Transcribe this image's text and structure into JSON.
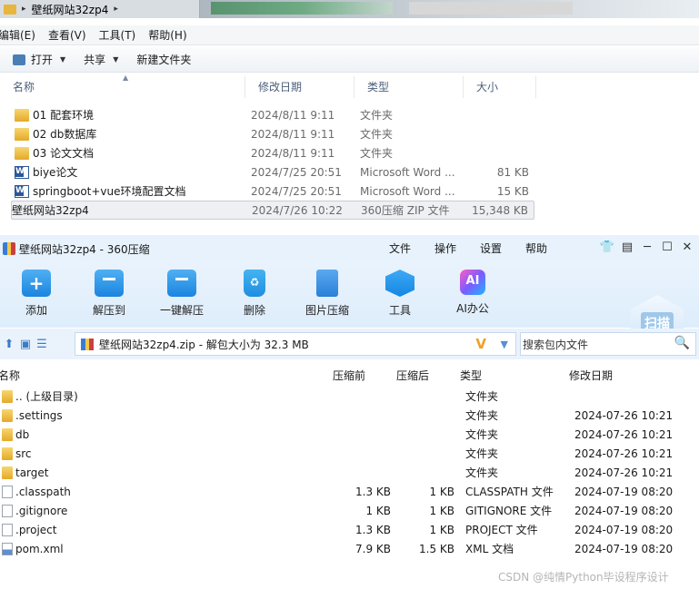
{
  "explorer": {
    "address": "壁纸网站32zp4",
    "menu": [
      "编辑(E)",
      "查看(V)",
      "工具(T)",
      "帮助(H)"
    ],
    "toolbar": {
      "open": "打开",
      "share": "共享",
      "new_folder": "新建文件夹"
    },
    "columns": {
      "name": "名称",
      "date": "修改日期",
      "type": "类型",
      "size": "大小"
    },
    "files": [
      {
        "name": "01 配套环境",
        "date": "2024/8/11 9:11",
        "type": "文件夹",
        "size": "",
        "icon": "folder-icon"
      },
      {
        "name": "02 db数据库",
        "date": "2024/8/11 9:11",
        "type": "文件夹",
        "size": "",
        "icon": "folder-icon"
      },
      {
        "name": "03 论文文档",
        "date": "2024/8/11 9:11",
        "type": "文件夹",
        "size": "",
        "icon": "folder-icon"
      },
      {
        "name": "biye论文",
        "date": "2024/7/25 20:51",
        "type": "Microsoft Word ...",
        "size": "81 KB",
        "icon": "word-icon"
      },
      {
        "name": "springboot+vue环境配置文档",
        "date": "2024/7/25 20:51",
        "type": "Microsoft Word ...",
        "size": "15 KB",
        "icon": "word-icon"
      },
      {
        "name": "壁纸网站32zp4",
        "date": "2024/7/26 10:22",
        "type": "360压缩 ZIP 文件",
        "size": "15,348 KB",
        "icon": "zip-icon"
      }
    ]
  },
  "zip": {
    "title": "壁纸网站32zp4 - 360压缩",
    "menu": [
      "文件",
      "操作",
      "设置",
      "帮助"
    ],
    "tools": [
      "添加",
      "解压到",
      "一键解压",
      "删除",
      "图片压缩",
      "工具",
      "AI办公"
    ],
    "scan": "扫描",
    "path": "壁纸网站32zp4.zip - 解包大小为 32.3 MB",
    "search_placeholder": "搜索包内文件",
    "columns": {
      "name": "名称",
      "orig": "压缩前",
      "comp": "压缩后",
      "type": "类型",
      "date": "修改日期"
    },
    "rows": [
      {
        "name": ".. (上级目录)",
        "orig": "",
        "comp": "",
        "type": "文件夹",
        "date": "",
        "icon": "folder-icon"
      },
      {
        "name": ".settings",
        "orig": "",
        "comp": "",
        "type": "文件夹",
        "date": "2024-07-26 10:21",
        "icon": "folder-icon"
      },
      {
        "name": "db",
        "orig": "",
        "comp": "",
        "type": "文件夹",
        "date": "2024-07-26 10:21",
        "icon": "folder-icon"
      },
      {
        "name": "src",
        "orig": "",
        "comp": "",
        "type": "文件夹",
        "date": "2024-07-26 10:21",
        "icon": "folder-icon"
      },
      {
        "name": "target",
        "orig": "",
        "comp": "",
        "type": "文件夹",
        "date": "2024-07-26 10:21",
        "icon": "folder-icon"
      },
      {
        "name": ".classpath",
        "orig": "1.3 KB",
        "comp": "1 KB",
        "type": "CLASSPATH 文件",
        "date": "2024-07-19 08:20",
        "icon": "file-icon"
      },
      {
        "name": ".gitignore",
        "orig": "1 KB",
        "comp": "1 KB",
        "type": "GITIGNORE 文件",
        "date": "2024-07-19 08:20",
        "icon": "file-icon"
      },
      {
        "name": ".project",
        "orig": "1.3 KB",
        "comp": "1 KB",
        "type": "PROJECT 文件",
        "date": "2024-07-19 08:20",
        "icon": "file-icon"
      },
      {
        "name": "pom.xml",
        "orig": "7.9 KB",
        "comp": "1.5 KB",
        "type": "XML 文档",
        "date": "2024-07-19 08:20",
        "icon": "xml-icon"
      }
    ]
  },
  "watermark": "CSDN @纯情Python毕设程序设计"
}
